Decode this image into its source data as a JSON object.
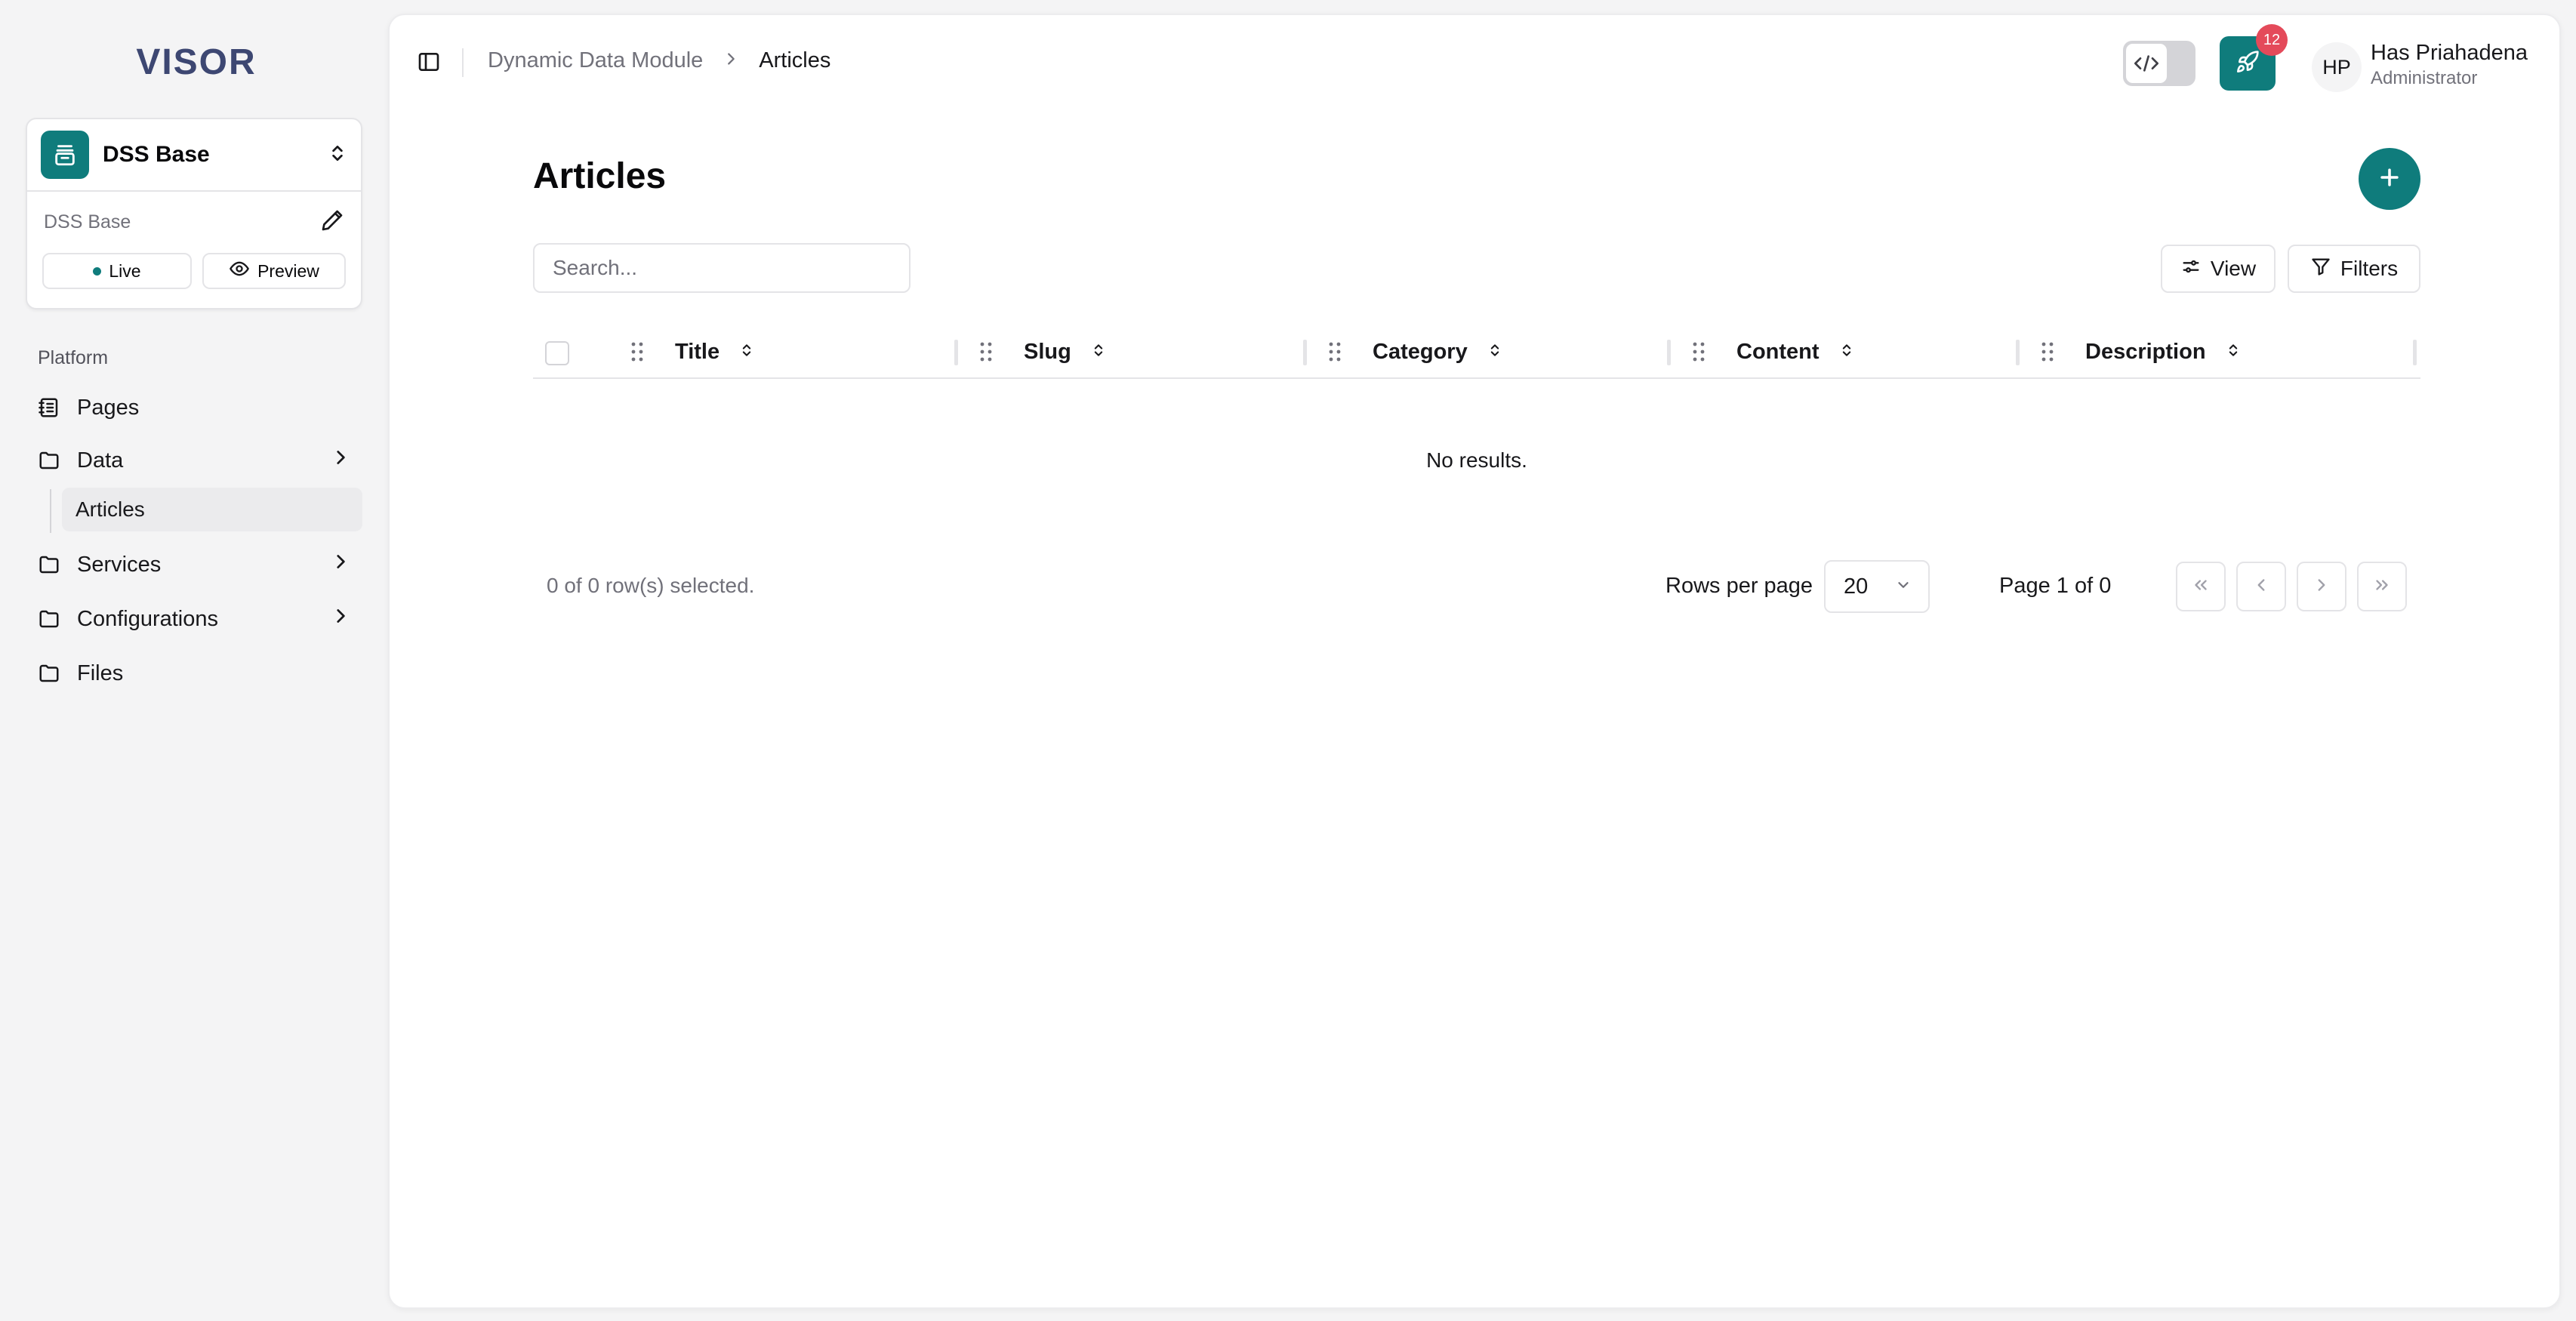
{
  "sidebar": {
    "logo_text": "VISOR",
    "project": {
      "name": "DSS Base",
      "sub_label": "DSS Base",
      "live_label": "Live",
      "preview_label": "Preview"
    },
    "group_label": "Platform",
    "items": [
      {
        "label": "Pages",
        "icon": "notebook-icon",
        "chevron": false
      },
      {
        "label": "Data",
        "icon": "folder-icon",
        "chevron": true
      },
      {
        "label": "Services",
        "icon": "folder-icon",
        "chevron": true
      },
      {
        "label": "Configurations",
        "icon": "folder-icon",
        "chevron": true
      },
      {
        "label": "Files",
        "icon": "folder-icon",
        "chevron": false
      }
    ],
    "sub_item_label": "Articles"
  },
  "header": {
    "breadcrumb_parent": "Dynamic Data Module",
    "breadcrumb_current": "Articles",
    "notification_count": "12",
    "user_initials": "HP",
    "user_name": "Has Priahadena",
    "user_role": "Administrator"
  },
  "main": {
    "title": "Articles",
    "search_placeholder": "Search...",
    "view_label": "View",
    "filters_label": "Filters",
    "columns": [
      "Title",
      "Slug",
      "Category",
      "Content",
      "Description"
    ],
    "empty_text": "No results.",
    "selected_text": "0 of 0 row(s) selected.",
    "rows_per_page_label": "Rows per page",
    "rows_per_page_value": "20",
    "page_info": "Page 1 of 0"
  },
  "colors": {
    "accent": "#0f7c7c",
    "badge": "#e44a5a",
    "logo": "#3d4772"
  }
}
